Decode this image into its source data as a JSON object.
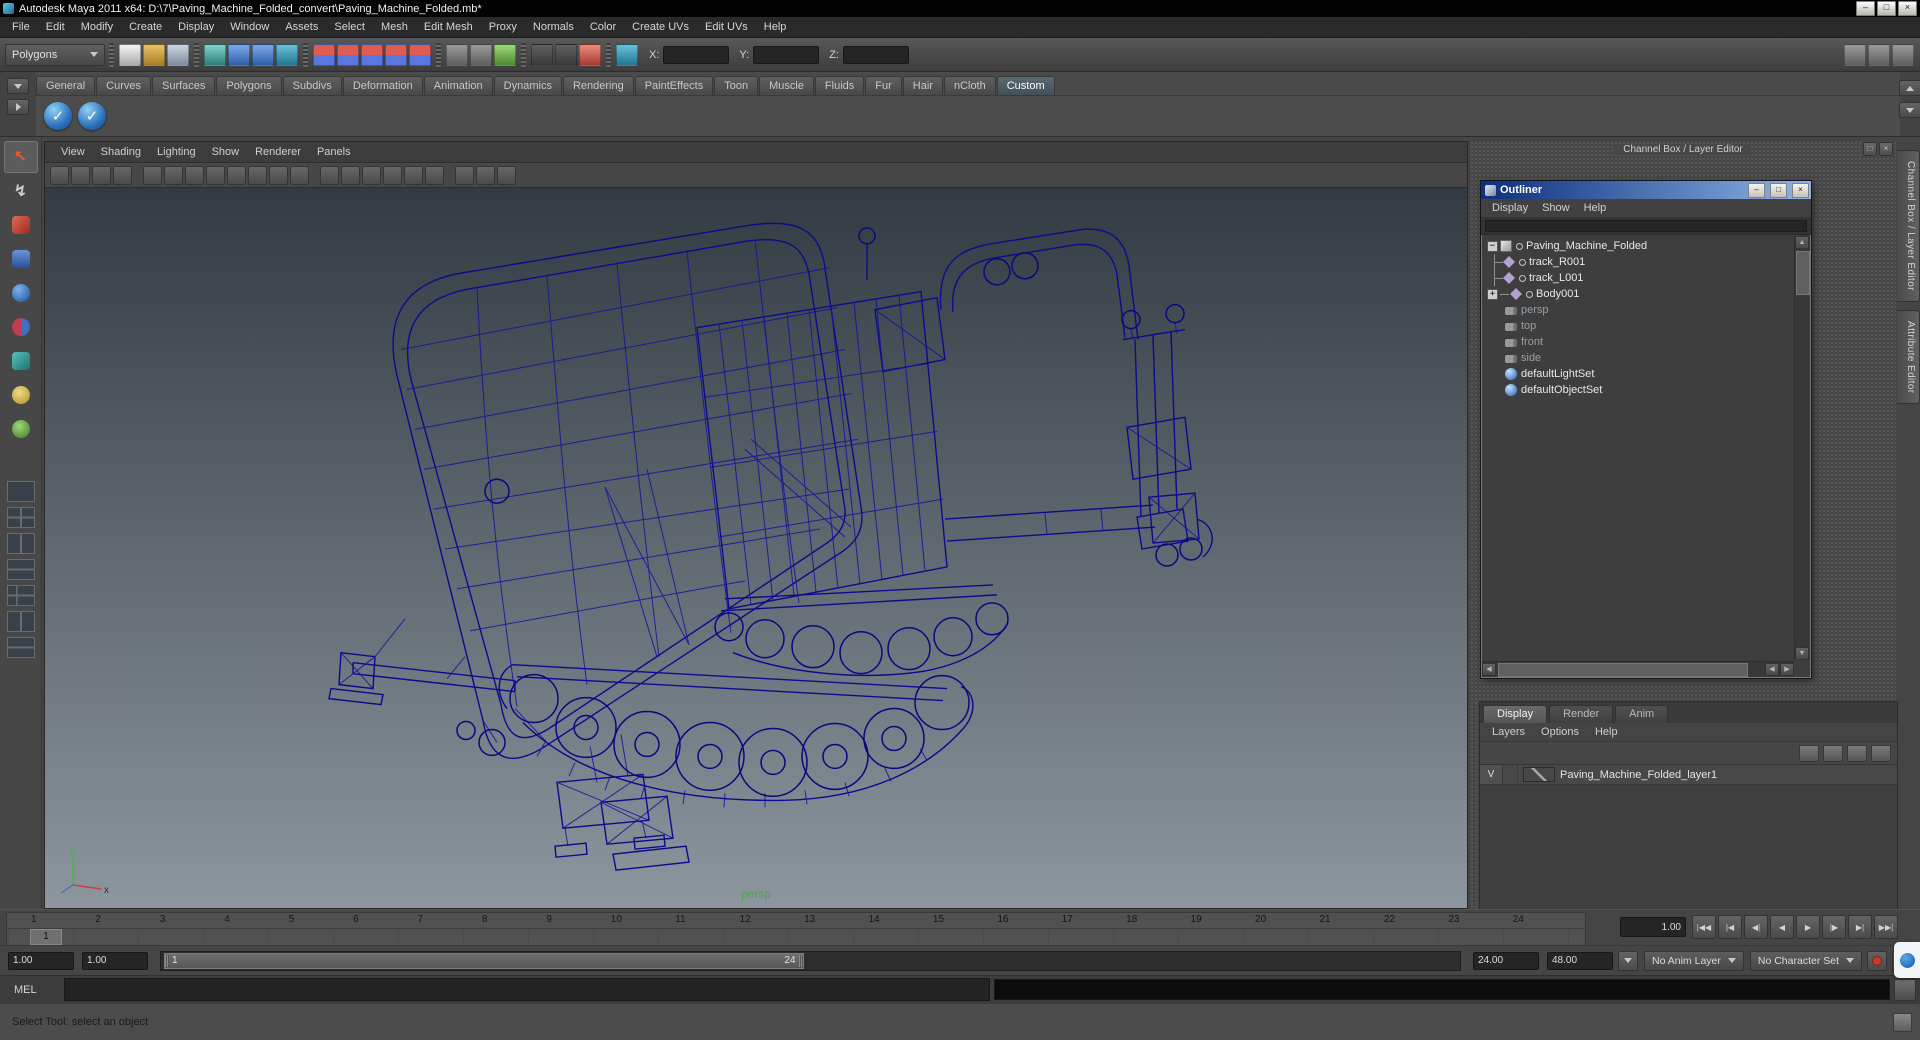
{
  "window": {
    "title": "Autodesk Maya 2011 x64: D:\\7\\Paving_Machine_Folded_convert\\Paving_Machine_Folded.mb*"
  },
  "icons": {
    "check": "✓",
    "minimize": "–",
    "maximize": "□",
    "close": "×",
    "collapse": "−",
    "expand": "+",
    "scroll_up": "▲",
    "scroll_down": "▼",
    "scroll_left": "◀",
    "scroll_right": "▶"
  },
  "menubar": {
    "items": [
      "File",
      "Edit",
      "Modify",
      "Create",
      "Display",
      "Window",
      "Assets",
      "Select",
      "Mesh",
      "Edit Mesh",
      "Proxy",
      "Normals",
      "Color",
      "Create UVs",
      "Edit UVs",
      "Help"
    ]
  },
  "statusline": {
    "mode_selector": "Polygons",
    "x_label": "X:",
    "y_label": "Y:",
    "z_label": "Z:"
  },
  "shelf": {
    "tabs": [
      "General",
      "Curves",
      "Surfaces",
      "Polygons",
      "Subdivs",
      "Deformation",
      "Animation",
      "Dynamics",
      "Rendering",
      "PaintEffects",
      "Toon",
      "Muscle",
      "Fluids",
      "Fur",
      "Hair",
      "nCloth",
      "Custom"
    ],
    "active_tab": "Custom"
  },
  "viewport": {
    "menus": [
      "View",
      "Shading",
      "Lighting",
      "Show",
      "Renderer",
      "Panels"
    ],
    "camera_label": "persp",
    "axis_y": "y",
    "axis_x": "x"
  },
  "right_dock": {
    "header": "Channel Box / Layer Editor",
    "vertical_tabs": [
      "Channel Box / Layer Editor",
      "Attribute Editor"
    ]
  },
  "outliner": {
    "title": "Outliner",
    "menus": [
      "Display",
      "Show",
      "Help"
    ],
    "items": [
      {
        "label": "Paving_Machine_Folded"
      },
      {
        "label": "track_R001"
      },
      {
        "label": "track_L001"
      },
      {
        "label": "Body001"
      },
      {
        "label": "persp"
      },
      {
        "label": "top"
      },
      {
        "label": "front"
      },
      {
        "label": "side"
      },
      {
        "label": "defaultLightSet"
      },
      {
        "label": "defaultObjectSet"
      }
    ]
  },
  "layer_editor": {
    "tabs": [
      "Display",
      "Render",
      "Anim"
    ],
    "active_tab": "Display",
    "menus": [
      "Layers",
      "Options",
      "Help"
    ],
    "layer": {
      "visibility": "V",
      "name": "Paving_Machine_Folded_layer1"
    }
  },
  "timeline": {
    "ticks": [
      1,
      2,
      3,
      4,
      5,
      6,
      7,
      8,
      9,
      10,
      11,
      12,
      13,
      14,
      15,
      16,
      17,
      18,
      19,
      20,
      21,
      22,
      23,
      24
    ],
    "current_frame": "1",
    "current_frame_field": "1.00",
    "playback": [
      "|◀◀",
      "|◀",
      "◀|",
      "◀",
      "▶",
      "|▶",
      "▶|",
      "▶▶|"
    ]
  },
  "range_slider": {
    "playback_start": "1.00",
    "anim_start": "1.00",
    "range_start": "1",
    "range_end": "24",
    "anim_end": "24.00",
    "playback_end": "48.00",
    "anim_layer": "No Anim Layer",
    "character_set": "No Character Set"
  },
  "command_line": {
    "label": "MEL"
  },
  "help_line": {
    "text": "Select Tool: select an object"
  }
}
